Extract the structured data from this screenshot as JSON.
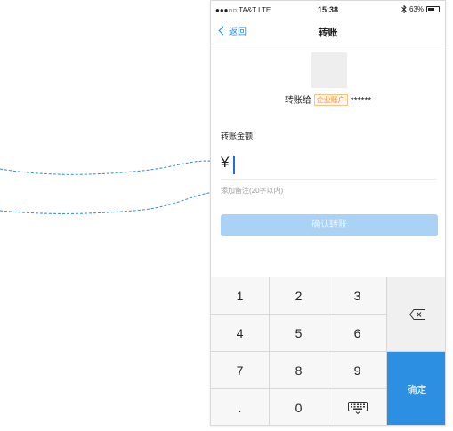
{
  "status_bar": {
    "carrier": "●●●○○ TA&T  LTE",
    "time": "15:38",
    "battery": "63%",
    "battery_level": 0.63
  },
  "nav": {
    "back_label": "返回",
    "title": "转账"
  },
  "payee": {
    "prefix": "转账给",
    "badge": "企业账户",
    "masked_name": "******"
  },
  "amount": {
    "label": "转账金额",
    "currency": "¥"
  },
  "remark": {
    "placeholder": "添加备注(20字以内)"
  },
  "confirm_button": "确认转账",
  "keypad": {
    "keys": [
      "1",
      "2",
      "3",
      "4",
      "5",
      "6",
      "7",
      "8",
      "9",
      ".",
      "0"
    ],
    "ok_label": "确定"
  },
  "colors": {
    "accent": "#1e8ae6",
    "confirm_disabled": "#a9d2f5",
    "ok_key": "#2d8fe2",
    "badge": "#f08519",
    "annotation_arrow": "#2a8ad8"
  }
}
